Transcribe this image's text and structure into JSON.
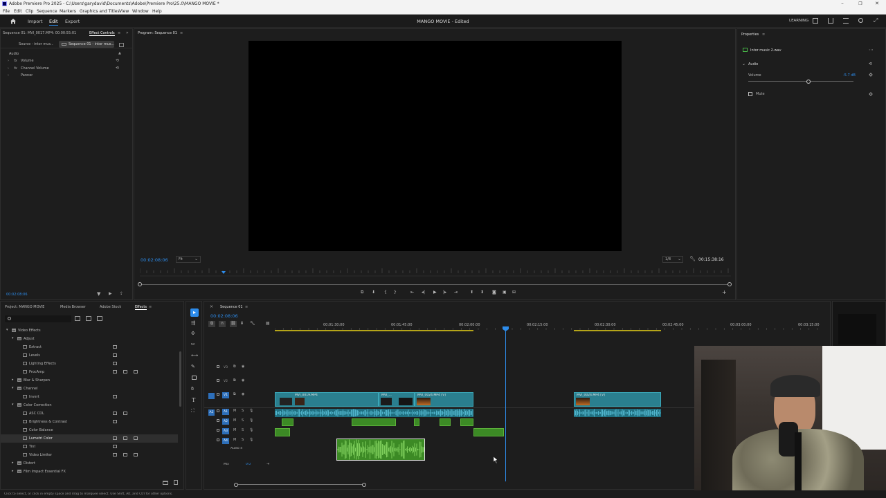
{
  "titlebar": {
    "title": "Adobe Premiere Pro 2025 - C:\\Users\\garydavid\\Documents\\Adobe\\Premiere Pro\\25.0\\MANGO MOVIE *"
  },
  "menubar": [
    "File",
    "Edit",
    "Clip",
    "Sequence",
    "Markers",
    "Graphics and Titles",
    "View",
    "Window",
    "Help"
  ],
  "workspace": {
    "tabs": [
      "Import",
      "Edit",
      "Export"
    ],
    "active_tab": "Edit",
    "project_title": "MANGO MOVIE - Edited",
    "learning_label": "LEARNING"
  },
  "effect_controls": {
    "source_label": "Sequence 01: MVI_0017.MP4: 00:00:55:01",
    "tab_label": "Effect Controls",
    "subtab_source": "Source - intor mus...",
    "subtab_seq": "Sequence 01 - intor mus...",
    "section": "Audio",
    "items": [
      "Volume",
      "Channel Volume",
      "Panner"
    ],
    "timecode": "00:02:08:06"
  },
  "program": {
    "title": "Program: Sequence 01",
    "timecode": "00:02:08:06",
    "fit": "Fit",
    "resolution": "1/8",
    "duration": "00:15:38:16"
  },
  "properties": {
    "title": "Properties",
    "clip_name": "Intor music 2.wav",
    "section": "Audio",
    "volume_label": "Volume",
    "volume_value": "-5.7 dB",
    "volume_level": 0.57,
    "mute_label": "Mute"
  },
  "project_panel": {
    "tabs": [
      "Project: MANGO MOVIE",
      "Media Browser",
      "Adobe Stock",
      "Effects"
    ],
    "active_tab": "Effects",
    "tree": [
      {
        "label": "Video Effects",
        "level": 1,
        "expanded": true,
        "folder": true
      },
      {
        "label": "Adjust",
        "level": 2,
        "expanded": true,
        "folder": true
      },
      {
        "label": "Extract",
        "level": 3,
        "badges": 1
      },
      {
        "label": "Levels",
        "level": 3,
        "badges": 1
      },
      {
        "label": "Lighting Effects",
        "level": 3,
        "badges": 1
      },
      {
        "label": "ProcAmp",
        "level": 3,
        "badges": 3
      },
      {
        "label": "Blur & Sharpen",
        "level": 2,
        "expanded": false,
        "folder": true
      },
      {
        "label": "Channel",
        "level": 2,
        "expanded": true,
        "folder": true
      },
      {
        "label": "Invert",
        "level": 3,
        "badges": 1
      },
      {
        "label": "Color Correction",
        "level": 2,
        "expanded": true,
        "folder": true
      },
      {
        "label": "ASC CDL",
        "level": 3,
        "badges": 2
      },
      {
        "label": "Brightness & Contrast",
        "level": 3,
        "badges": 1
      },
      {
        "label": "Color Balance",
        "level": 3,
        "badges": 0
      },
      {
        "label": "Lumetri Color",
        "level": 3,
        "badges": 3,
        "selected": true
      },
      {
        "label": "Tint",
        "level": 3,
        "badges": 1
      },
      {
        "label": "Video Limiter",
        "level": 3,
        "badges": 3
      },
      {
        "label": "Distort",
        "level": 2,
        "expanded": false,
        "folder": true
      },
      {
        "label": "Film Impact Essential FX",
        "level": 2,
        "expanded": false,
        "folder": true
      }
    ]
  },
  "timeline": {
    "title": "Sequence 01",
    "timecode": "00:02:08:06",
    "ruler": [
      "00:01:30:00",
      "00:01:45:00",
      "00:02:00:00",
      "00:02:15:00",
      "00:02:30:00",
      "00:02:45:00",
      "00:03:00:00",
      "00:03:15:00"
    ],
    "video_tracks": [
      "V3",
      "V2",
      "V1"
    ],
    "audio_tracks": [
      "A1",
      "A2",
      "A3",
      "A4"
    ],
    "a4_name": "Audio 4",
    "mix_label": "Mix",
    "mix_value": "0.0",
    "clips": {
      "v1a": "MVI_0019.MP4",
      "v1b": "MVI_...",
      "v1c": "MVI_0024.MP4 [V]",
      "v1d": "MVI_0024.MP4 [V]"
    }
  },
  "statusbar": {
    "text": "Click to select, or click in empty space and drag to marquee select. Use Shift, Alt, and Ctrl for other options."
  }
}
